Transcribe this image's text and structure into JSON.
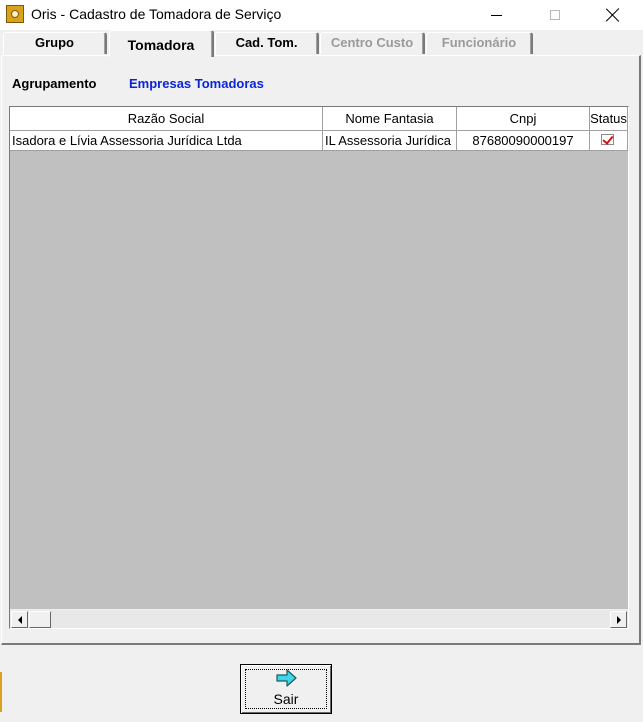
{
  "window": {
    "title": "Oris - Cadastro de Tomadora de Serviço"
  },
  "tabs": [
    {
      "label": "Grupo",
      "state": "normal"
    },
    {
      "label": "Tomadora",
      "state": "active"
    },
    {
      "label": "Cad. Tom.",
      "state": "normal"
    },
    {
      "label": "Centro Custo",
      "state": "disabled"
    },
    {
      "label": "Funcionário",
      "state": "disabled"
    }
  ],
  "agrupamento": {
    "label": "Agrupamento",
    "value": "Empresas Tomadoras",
    "value_color": "#0a24d8"
  },
  "grid": {
    "columns": [
      "Razão Social",
      "Nome Fantasia",
      "Cnpj",
      "Status"
    ],
    "rows": [
      {
        "razao_social": "Isadora e Lívia Assessoria Jurídica Ltda",
        "nome_fantasia": "IL Assessoria Jurídica",
        "cnpj": "87680090000197",
        "status": "checked"
      }
    ],
    "background": "#c0c0c0"
  },
  "buttons": {
    "sair_label": "Sair",
    "sair_icon": "arrow-right-icon"
  },
  "colors": {
    "check": "#d01010",
    "arrow_icon": "#3fd6e6"
  }
}
